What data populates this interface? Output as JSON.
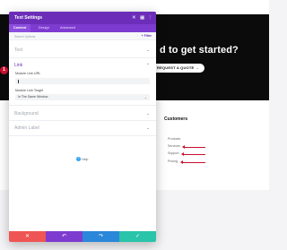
{
  "page": {
    "cta_heading": "d to get started?",
    "cta_button": "REQUEST A QUOTE →",
    "footer_title": "Customers",
    "footer_links": [
      "Products",
      "Services",
      "Support",
      "Pricing"
    ]
  },
  "modal": {
    "title": "Text Settings",
    "header_icons": [
      "close-icon",
      "grid-icon",
      "more-icon"
    ],
    "tabs": [
      "Content",
      "Design",
      "Advanced"
    ],
    "active_tab": "Content",
    "search_placeholder": "Search Options",
    "filter_label": "+ Filter",
    "sections": {
      "text": "Text",
      "link": "Link",
      "background": "Background",
      "admin_label": "Admin Label"
    },
    "link_fields": {
      "url_label": "Module Link URL",
      "url_value": "",
      "target_label": "Module Link Target",
      "target_value": "In The Same Window"
    },
    "marker_number": "1",
    "help_label": "Help",
    "footer_buttons": [
      {
        "name": "discard",
        "color": "#ef5555",
        "icon": "close-icon"
      },
      {
        "name": "undo",
        "color": "#7e3bd0",
        "icon": "undo-icon"
      },
      {
        "name": "redo",
        "color": "#2b87da",
        "icon": "redo-icon"
      },
      {
        "name": "save",
        "color": "#29c4a9",
        "icon": "check-icon"
      }
    ]
  }
}
